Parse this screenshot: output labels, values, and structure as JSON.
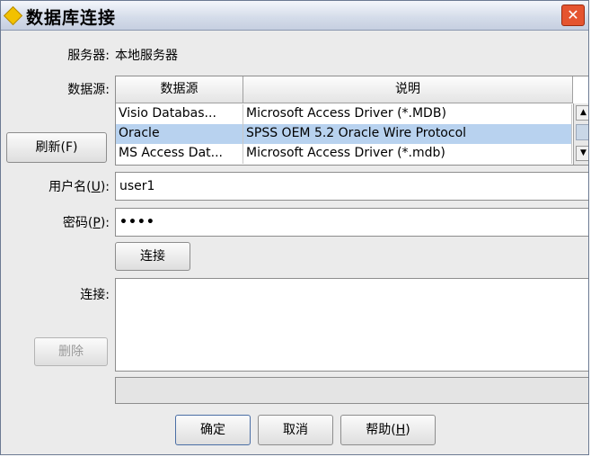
{
  "window": {
    "title": "数据库连接",
    "close_glyph": "✕"
  },
  "server": {
    "label": "服务器:",
    "value": "本地服务器"
  },
  "datasource": {
    "label": "数据源:",
    "columns": [
      "数据源",
      "说明"
    ],
    "rows": [
      {
        "name": "Visio Databas...",
        "desc": "Microsoft Access Driver (*.MDB)",
        "selected": false
      },
      {
        "name": "Oracle",
        "desc": "SPSS OEM 5.2 Oracle Wire Protocol",
        "selected": true
      },
      {
        "name": "MS Access Dat...",
        "desc": "Microsoft Access Driver (*.mdb)",
        "selected": false
      }
    ]
  },
  "buttons": {
    "refresh": "刷新(F)",
    "connect": "连接",
    "delete": "删除",
    "ok": "确定",
    "cancel": "取消",
    "help_prefix": "帮助(",
    "help_key": "H",
    "help_suffix": ")"
  },
  "username": {
    "label_prefix": "用户名(",
    "label_key": "U",
    "label_suffix": "):",
    "value": "user1"
  },
  "password": {
    "label_prefix": "密码(",
    "label_key": "P",
    "label_suffix": "):",
    "value": "••••"
  },
  "connections": {
    "label": "连接:",
    "status_text": ""
  },
  "colors": {
    "selection": "#b8d2ef",
    "title_accent": "#f2c100",
    "close": "#e5542f"
  }
}
